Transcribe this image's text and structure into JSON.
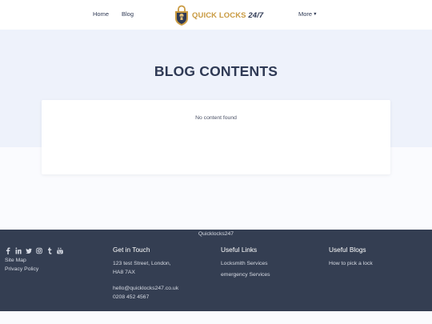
{
  "header": {
    "nav": {
      "home": "Home",
      "blog": "Blog",
      "more": "More"
    },
    "logo": {
      "word1": "QUICK LOCKS",
      "word2": "24/7"
    },
    "colors": {
      "gold": "#c99a41",
      "navy": "#2f3a55"
    }
  },
  "hero": {
    "title": "BLOG CONTENTS"
  },
  "content": {
    "empty_message": "No content found"
  },
  "footer": {
    "brand": "Quicklocks247",
    "social_icons": [
      "facebook-icon",
      "linkedin-icon",
      "twitter-icon",
      "instagram-icon",
      "tumblr-icon",
      "youtube-icon"
    ],
    "left_links": {
      "site_map": "Site Map",
      "privacy": "Privacy Policy"
    },
    "get_in_touch": {
      "title": "Get in Touch",
      "address_line1": "123 test Street, London,",
      "address_line2": "HA8 7AX",
      "email": "hello@quicklocks247.co.uk",
      "phone": "0208 452 4567"
    },
    "useful_links": {
      "title": "Useful Links",
      "items": [
        "Locksmith Services",
        "emergency Services"
      ]
    },
    "useful_blogs": {
      "title": "Useful Blogs",
      "items": [
        "How to pick a lock"
      ]
    },
    "colors": {
      "background": "#343e52",
      "text": "#d7dbe4"
    }
  }
}
